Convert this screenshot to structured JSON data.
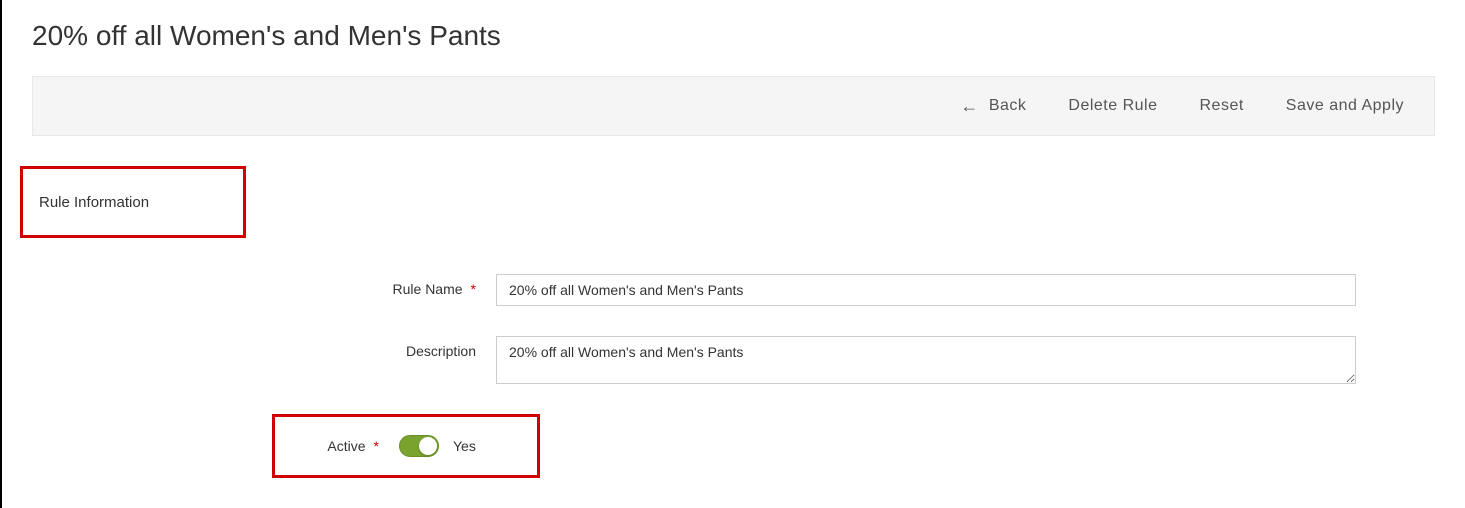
{
  "header": {
    "title": "20% off all Women's and Men's Pants"
  },
  "actions": {
    "back": "Back",
    "delete": "Delete Rule",
    "reset": "Reset",
    "save": "Save and Apply"
  },
  "sidebar": {
    "tab_label": "Rule Information"
  },
  "form": {
    "rule_name": {
      "label": "Rule Name",
      "value": "20% off all Women's and Men's Pants"
    },
    "description": {
      "label": "Description",
      "value": "20% off all Women's and Men's Pants"
    },
    "active": {
      "label": "Active",
      "status_text": "Yes"
    }
  }
}
